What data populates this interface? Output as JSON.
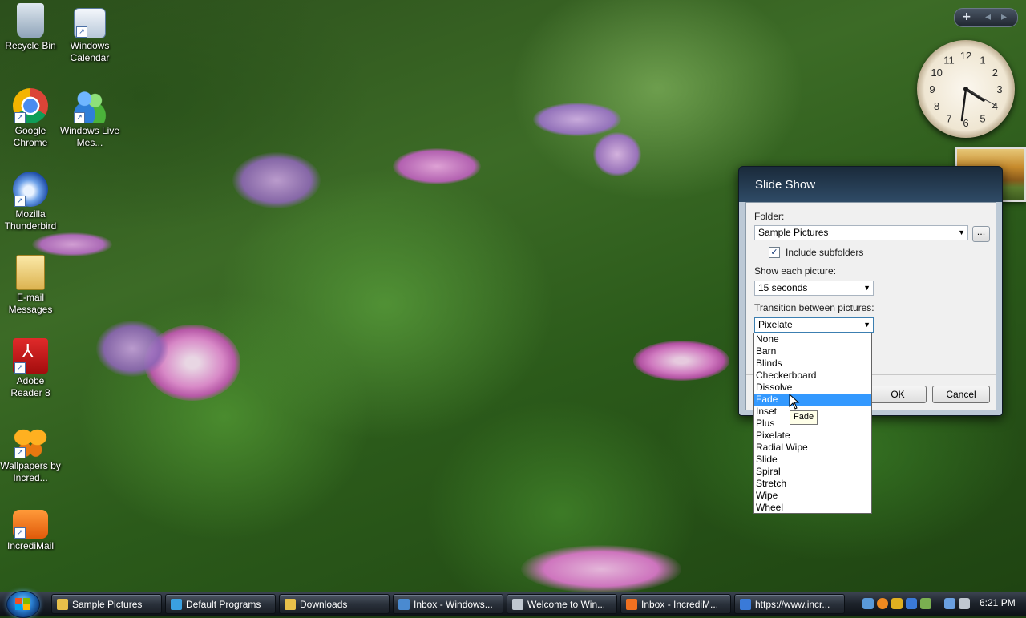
{
  "desktop": {
    "icons": [
      {
        "label": "Recycle Bin",
        "icon": "recycle-bin-icon"
      },
      {
        "label": "Windows Calendar",
        "icon": "calendar-icon"
      },
      {
        "label": "Google Chrome",
        "icon": "chrome-icon"
      },
      {
        "label": "Windows Live Mes...",
        "icon": "messenger-icon"
      },
      {
        "label": "Mozilla Thunderbird",
        "icon": "thunderbird-icon"
      },
      {
        "label": "E-mail Messages",
        "icon": "folder-icon"
      },
      {
        "label": "Adobe Reader 8",
        "icon": "adobe-reader-icon"
      },
      {
        "label": "Wallpapers by Incred...",
        "icon": "butterfly-icon"
      },
      {
        "label": "IncrediMail",
        "icon": "envelope-icon"
      }
    ]
  },
  "gadgets": {
    "plus": "+",
    "prev": "◂",
    "next": "▸",
    "clock_numbers": [
      "12",
      "1",
      "2",
      "3",
      "4",
      "5",
      "6",
      "7",
      "8",
      "9",
      "10",
      "11"
    ]
  },
  "dialog": {
    "title": "Slide Show",
    "folder_label": "Folder:",
    "folder_value": "Sample Pictures",
    "browse_label": "...",
    "subfolders_label": "Include subfolders",
    "subfolders_checked": true,
    "show_each_label": "Show each picture:",
    "show_each_value": "15 seconds",
    "transition_label": "Transition between pictures:",
    "transition_value": "Pixelate",
    "ok_label": "OK",
    "cancel_label": "Cancel",
    "transition_options": [
      "None",
      "Barn",
      "Blinds",
      "Checkerboard",
      "Dissolve",
      "Fade",
      "Inset",
      "Plus",
      "Pixelate",
      "Radial Wipe",
      "Slide",
      "Spiral",
      "Stretch",
      "Wipe",
      "Wheel"
    ],
    "highlighted_option": "Fade",
    "tooltip": "Fade"
  },
  "taskbar": {
    "tasks": [
      {
        "label": "Sample Pictures",
        "icon": "folder-icon",
        "color": "#e8c04a"
      },
      {
        "label": "Default Programs",
        "icon": "default-programs-icon",
        "color": "#3aa0e0"
      },
      {
        "label": "Downloads",
        "icon": "folder-icon",
        "color": "#e8c04a"
      },
      {
        "label": "Inbox - Windows...",
        "icon": "mail-icon",
        "color": "#4a8ad0"
      },
      {
        "label": "Welcome to Win...",
        "icon": "welcome-icon",
        "color": "#c0c8d0"
      },
      {
        "label": "Inbox - IncrediM...",
        "icon": "envelope-icon",
        "color": "#f07020"
      },
      {
        "label": "https://www.incr...",
        "icon": "ie-icon",
        "color": "#3a7ad8"
      }
    ],
    "time": "6:21 PM"
  },
  "colors": {
    "selection": "#3399ff",
    "taskbar": "#1d232b",
    "dialog_header": "#2f4b66"
  }
}
